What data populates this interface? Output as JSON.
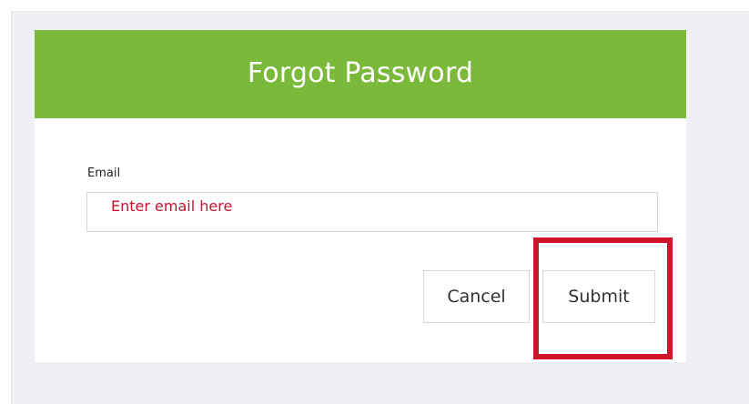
{
  "dialog": {
    "title": "Forgot Password",
    "header_color": "#7ab93a"
  },
  "form": {
    "email_label": "Email",
    "email_placeholder": "Enter email here",
    "email_value": ""
  },
  "buttons": {
    "cancel_label": "Cancel",
    "submit_label": "Submit"
  },
  "annotation": {
    "highlight_color": "#d0142a",
    "highlighted_element": "submit-button"
  }
}
